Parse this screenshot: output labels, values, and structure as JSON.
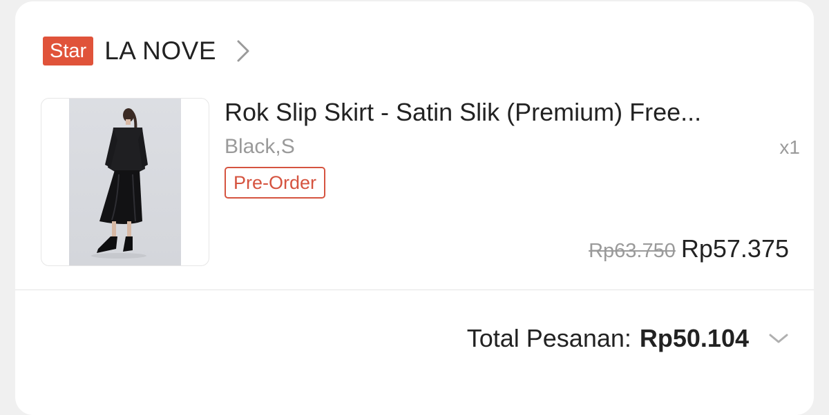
{
  "shop": {
    "badge": "Star",
    "name": "LA NOVE",
    "chevron_icon": "chevron-right-icon"
  },
  "product": {
    "image_icon": "product-photo",
    "title": "Rok Slip Skirt - Satin Slik (Premium) Free...",
    "variant": "Black,S",
    "quantity": "x1",
    "tag": "Pre-Order",
    "original_price": "Rp63.750",
    "price": "Rp57.375"
  },
  "order": {
    "total_label": "Total Pesanan:",
    "total_value": "Rp50.104",
    "expand_icon": "chevron-down-icon"
  },
  "colors": {
    "accent": "#e0533a",
    "text": "#222222",
    "muted": "#9a9a9a"
  }
}
